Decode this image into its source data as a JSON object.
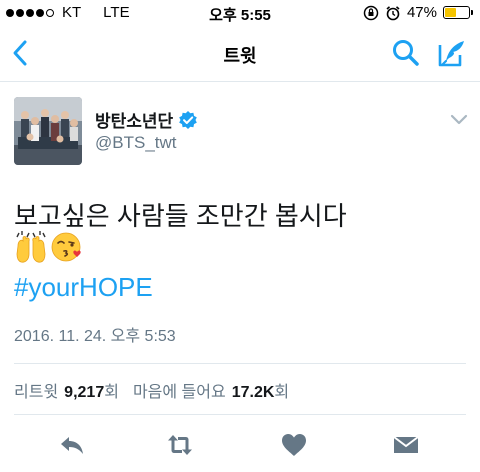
{
  "status_bar": {
    "carrier": "KT",
    "network": "LTE",
    "time": "오후 5:55",
    "battery_percent": "47%",
    "battery_level": 0.47
  },
  "nav": {
    "title": "트윗",
    "back_icon": "chevron-left-icon",
    "search_icon": "search-icon",
    "compose_icon": "compose-icon"
  },
  "tweet": {
    "user_name": "방탄소년단",
    "handle": "@BTS_twt",
    "text": "보고싶은 사람들 조만간 봅시다",
    "emojis": [
      "raising-hands",
      "face-blowing-kiss"
    ],
    "hashtag": "#yourHOPE",
    "timestamp": "2016. 11. 24. 오후 5:53"
  },
  "stats": {
    "retweet_label": "리트윗",
    "retweet_count": "9,217",
    "retweet_unit": "회",
    "like_label": "마음에 들어요",
    "like_count": "17.2K",
    "like_unit": "회"
  },
  "colors": {
    "accent": "#1da1f2",
    "secondary_text": "#657786",
    "action_icon": "#657786",
    "battery": "#f5c400"
  }
}
